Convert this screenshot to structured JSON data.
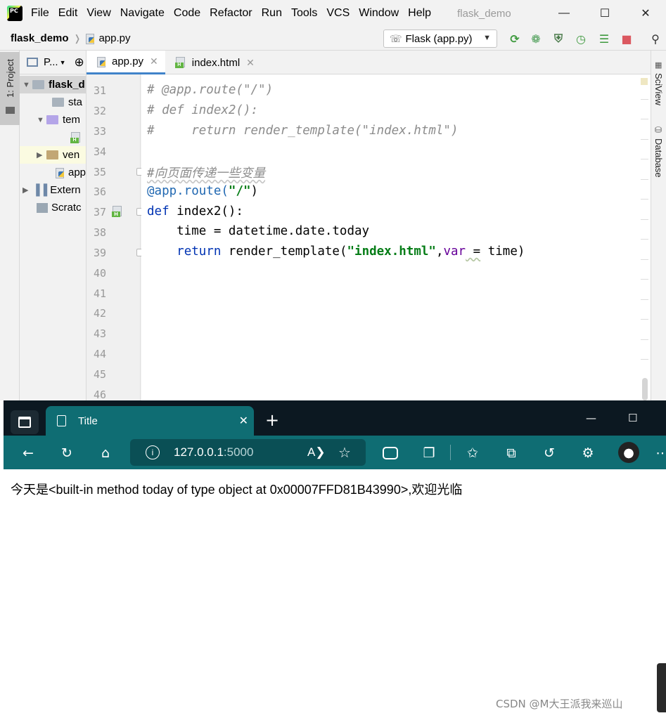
{
  "ide": {
    "menu": [
      "File",
      "Edit",
      "View",
      "Navigate",
      "Code",
      "Refactor",
      "Run",
      "Tools",
      "VCS",
      "Window",
      "Help"
    ],
    "window_title": "flask_demo",
    "logo_text": "PC",
    "breadcrumb": {
      "project": "flask_demo",
      "file": "app.py"
    },
    "run_config": "Flask (app.py)",
    "left_tool_tab": "1: Project",
    "project_panel": {
      "header": "P...",
      "items": [
        {
          "label": "flask_d",
          "bold": true
        },
        {
          "label": "sta"
        },
        {
          "label": "tem"
        },
        {
          "label": "ven"
        },
        {
          "label": "app"
        },
        {
          "label": "Extern"
        },
        {
          "label": "Scratc"
        }
      ]
    },
    "tabs": [
      {
        "label": "app.py",
        "active": true
      },
      {
        "label": "index.html",
        "active": false
      }
    ],
    "right_tools": [
      "SciView",
      "Database"
    ],
    "line_numbers": [
      "31",
      "32",
      "33",
      "34",
      "35",
      "36",
      "37",
      "38",
      "39",
      "40",
      "41",
      "42",
      "43",
      "44",
      "45",
      "46"
    ],
    "code": {
      "l31": "# @app.route(\"/\")",
      "l32": "# def index2():",
      "l33": "#     return render_template(\"index.html\")",
      "l35": "#向页面传递一些变量",
      "l36_deco": "@app.route(",
      "l36_str": "\"/\"",
      "l36_end": ")",
      "l37_kw": "def",
      "l37_rest": " index2():",
      "l38": "    time = datetime.date.today",
      "l39_kw": "return",
      "l39_a": " render_template(",
      "l39_str": "\"index.html\"",
      "l39_comma": ",",
      "l39_param": "var",
      "l39_eq": " =",
      "l39_end": " time)"
    }
  },
  "browser": {
    "tab_title": "Title",
    "url_host": "127.0.0.1",
    "url_port": ":5000",
    "page_text": "今天是<built-in method today of type object at 0x00007FFD81B43990>,欢迎光临",
    "watermark": "CSDN @M大王派我来巡山"
  }
}
